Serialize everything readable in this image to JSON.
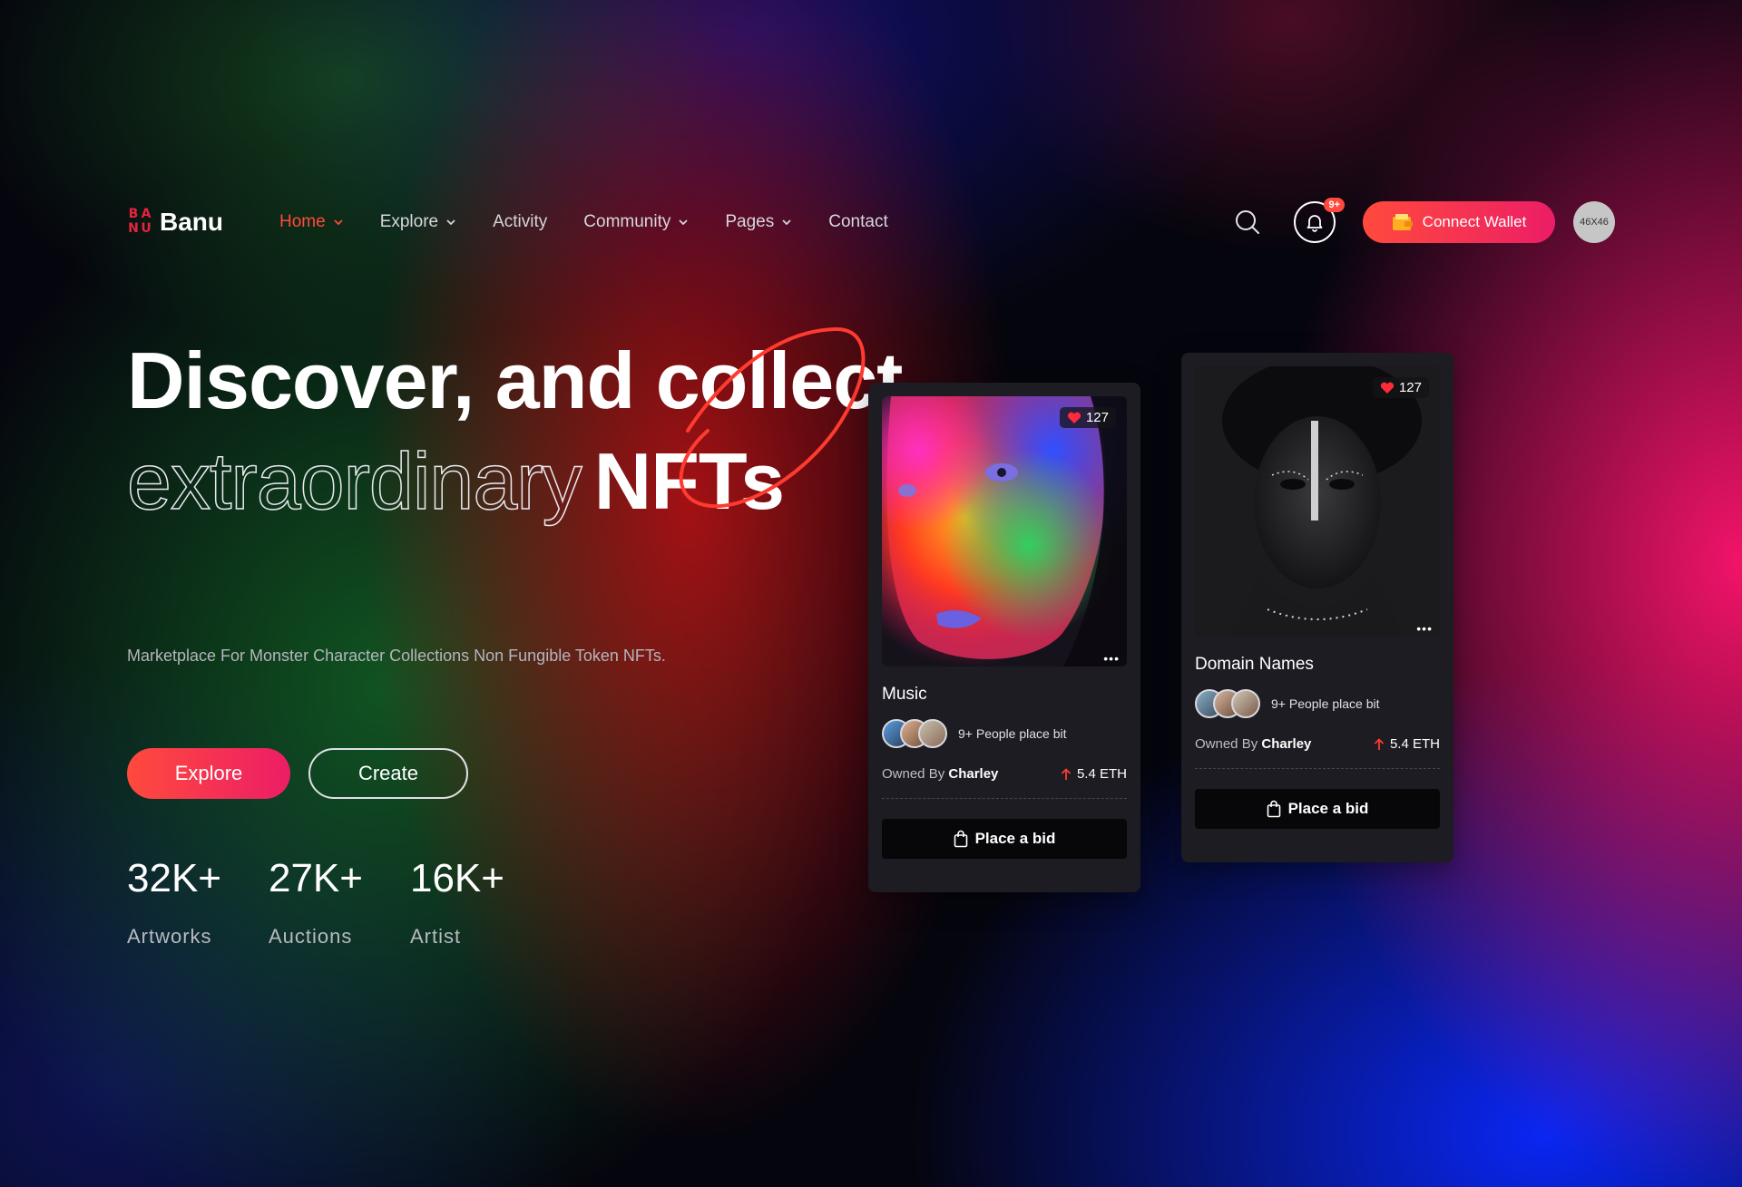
{
  "brand": {
    "logo_mark": [
      "B",
      "A",
      "N",
      "U"
    ],
    "name": "Banu"
  },
  "nav": {
    "items": [
      {
        "label": "Home",
        "has_dropdown": true,
        "active": true
      },
      {
        "label": "Explore",
        "has_dropdown": true,
        "active": false
      },
      {
        "label": "Activity",
        "has_dropdown": false,
        "active": false
      },
      {
        "label": "Community",
        "has_dropdown": true,
        "active": false
      },
      {
        "label": "Pages",
        "has_dropdown": true,
        "active": false
      },
      {
        "label": "Contact",
        "has_dropdown": false,
        "active": false
      }
    ],
    "search_icon": "search-icon",
    "notification_badge": "9+",
    "wallet_label": "Connect Wallet",
    "avatar_placeholder": "46X46"
  },
  "hero": {
    "line1": "Discover, and collect",
    "line2_outline": "extraordinary",
    "line2_strong": "NFTs",
    "subtitle": "Marketplace For Monster Character Collections Non Fungible Token NFTs.",
    "explore_label": "Explore",
    "create_label": "Create"
  },
  "stats": [
    {
      "value": "32K+",
      "label": "Artworks"
    },
    {
      "value": "27K+",
      "label": "Auctions"
    },
    {
      "value": "16K+",
      "label": "Artist"
    }
  ],
  "cards": [
    {
      "title": "Music",
      "likes": "127",
      "bidders_text": "9+ People place bit",
      "owner_prefix": "Owned By",
      "owner": "Charley",
      "price": "5.4 ETH",
      "bid_label": "Place a bid"
    },
    {
      "title": "Domain Names",
      "likes": "127",
      "bidders_text": "9+ People place bit",
      "owner_prefix": "Owned By",
      "owner": "Charley",
      "price": "5.4 ETH",
      "bid_label": "Place a bid"
    }
  ],
  "colors": {
    "accent": "#ff4a3d",
    "accent2": "#ec1d66",
    "card_bg": "#1c1c22"
  }
}
